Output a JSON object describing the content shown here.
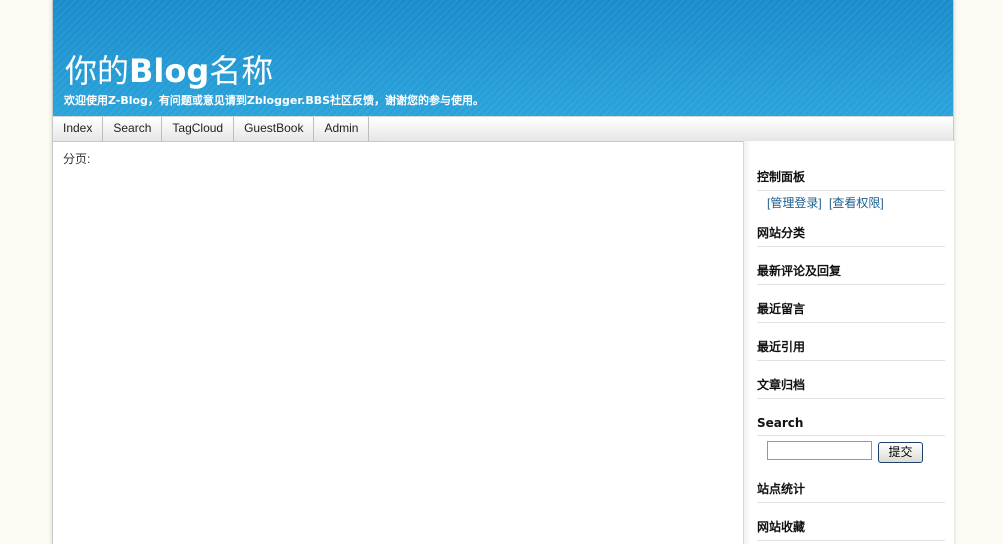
{
  "header": {
    "title_cn1": "你的",
    "title_blog": "Blog",
    "title_cn2": "名称",
    "subtitle": "欢迎使用Z-Blog，有问题或意见请到Zblogger.BBS社区反馈，谢谢您的参与使用。"
  },
  "nav": {
    "items": [
      {
        "label": "Index"
      },
      {
        "label": "Search"
      },
      {
        "label": "TagCloud"
      },
      {
        "label": "GuestBook"
      },
      {
        "label": "Admin"
      }
    ]
  },
  "main": {
    "pager_label": "分页:"
  },
  "sidebar": {
    "control_panel": "控制面板",
    "login_link": "[管理登录]",
    "permissions_link": "[查看权限]",
    "categories": "网站分类",
    "latest_comments": "最新评论及回复",
    "recent_messages": "最近留言",
    "recent_trackbacks": "最近引用",
    "archives": "文章归档",
    "search_title": "Search",
    "search_button": "提交",
    "search_value": "",
    "site_stats": "站点统计",
    "favorites": "网站收藏"
  },
  "colors": {
    "header_blue": "#2aa3da",
    "link_blue": "#1b5f8f"
  }
}
